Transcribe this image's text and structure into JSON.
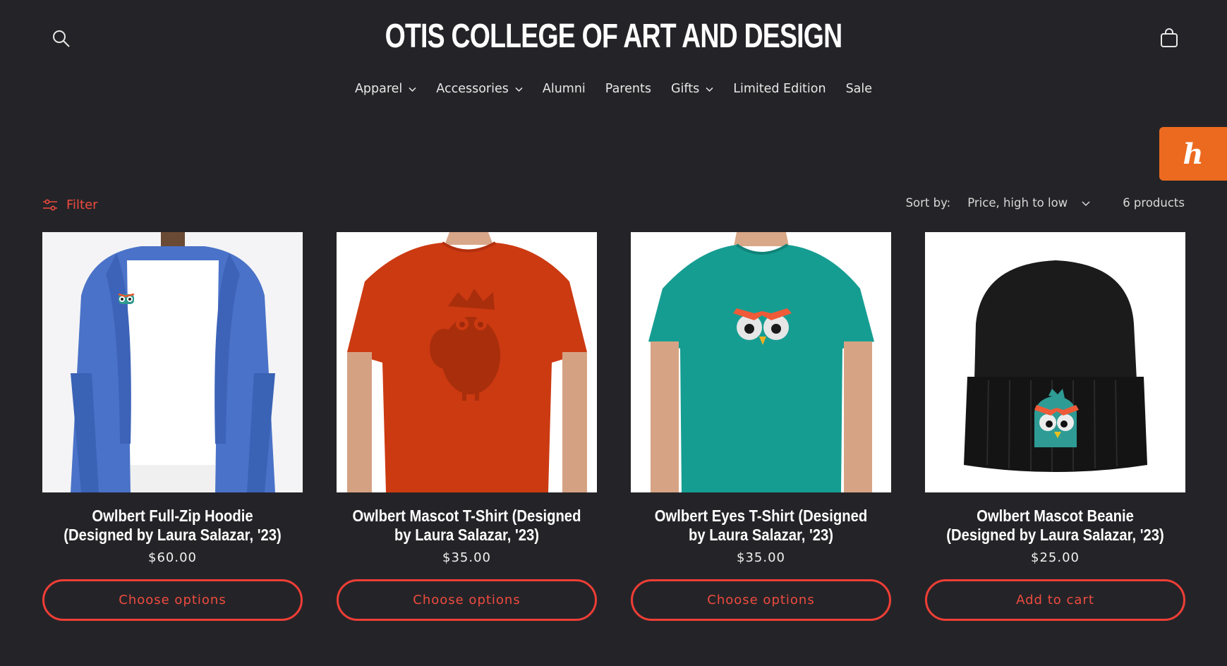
{
  "header": {
    "logo": "OTIS COLLEGE OF ART AND DESIGN"
  },
  "nav": [
    {
      "label": "Apparel",
      "has_dropdown": true
    },
    {
      "label": "Accessories",
      "has_dropdown": true
    },
    {
      "label": "Alumni",
      "has_dropdown": false
    },
    {
      "label": "Parents",
      "has_dropdown": false
    },
    {
      "label": "Gifts",
      "has_dropdown": true
    },
    {
      "label": "Limited Edition",
      "has_dropdown": false
    },
    {
      "label": "Sale",
      "has_dropdown": false
    }
  ],
  "honey": {
    "glyph": "h"
  },
  "toolbar": {
    "filter_label": "Filter",
    "sort_label": "Sort by:",
    "sort_value": "Price, high to low",
    "count": "6 products"
  },
  "products": [
    {
      "title": "Owlbert Full-Zip Hoodie (Designed by Laura Salazar, '23)",
      "price": "$60.00",
      "button": "Choose options",
      "image": "blue-zip-hoodie"
    },
    {
      "title": "Owlbert Mascot T-Shirt (Designed by Laura Salazar, '23)",
      "price": "$35.00",
      "button": "Choose options",
      "image": "red-owl-tshirt"
    },
    {
      "title": "Owlbert Eyes T-Shirt (Designed by Laura Salazar, '23)",
      "price": "$35.00",
      "button": "Choose options",
      "image": "teal-eyes-tshirt"
    },
    {
      "title": "Owlbert Mascot Beanie (Designed by Laura Salazar, '23)",
      "price": "$25.00",
      "button": "Add to cart",
      "image": "black-beanie"
    }
  ],
  "colors": {
    "background": "#242428",
    "accent": "#ef3e36",
    "honey": "#ec6a1f"
  }
}
